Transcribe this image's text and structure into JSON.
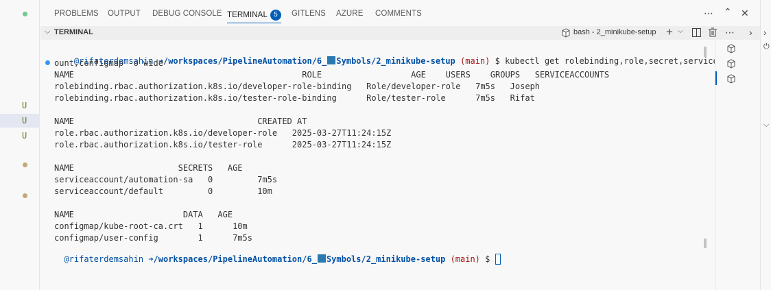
{
  "panel_tabs": [
    {
      "label": "PROBLEMS"
    },
    {
      "label": "OUTPUT"
    },
    {
      "label": "DEBUG CONSOLE"
    },
    {
      "label": "TERMINAL",
      "badge": "5",
      "active": true
    },
    {
      "label": "GITLENS"
    },
    {
      "label": "AZURE"
    },
    {
      "label": "COMMENTS"
    }
  ],
  "header_icons": [
    "more-icon",
    "maximize-icon",
    "close-icon"
  ],
  "terminal_bar": {
    "title": "TERMINAL",
    "shell_label": "bash - 2_minikube-setup",
    "icons": [
      "plus-icon",
      "dropdown-icon",
      "split-icon",
      "trash-icon",
      "more-icon",
      "chevron-right-icon"
    ]
  },
  "gutter": {
    "markers": [
      "U",
      "U",
      "U"
    ]
  },
  "prompt": {
    "user": "@rifaterdemsahin",
    "arrow": "➜",
    "path_pre": "/workspaces/PipelineAutomation/6_",
    "path_post": "Symbols/2_minikube-setup",
    "branch": "(main)",
    "dollar": "$"
  },
  "command": "kubectl get rolebinding,role,secret,serviceacc",
  "command_wrap": "ount,configmap -o wide",
  "output_lines": [
    "NAME                                              ROLE                  AGE    USERS    GROUPS   SERVICEACCOUNTS",
    "rolebinding.rbac.authorization.k8s.io/developer-role-binding   Role/developer-role   7m5s   Joseph",
    "rolebinding.rbac.authorization.k8s.io/tester-role-binding      Role/tester-role      7m5s   Rifat",
    "",
    "NAME                                     CREATED AT",
    "role.rbac.authorization.k8s.io/developer-role   2025-03-27T11:24:15Z",
    "role.rbac.authorization.k8s.io/tester-role      2025-03-27T11:24:15Z",
    "",
    "NAME                     SECRETS   AGE",
    "serviceaccount/automation-sa   0         7m5s",
    "serviceaccount/default         0         10m",
    "",
    "NAME                      DATA   AGE",
    "configmap/kube-root-ca.crt   1      10m",
    "configmap/user-config        1      7m5s"
  ],
  "colors": {
    "accent": "#005fb8",
    "prompt_user": "#0451a5",
    "branch": "#a31515",
    "gutter_u": "#587c0c"
  }
}
